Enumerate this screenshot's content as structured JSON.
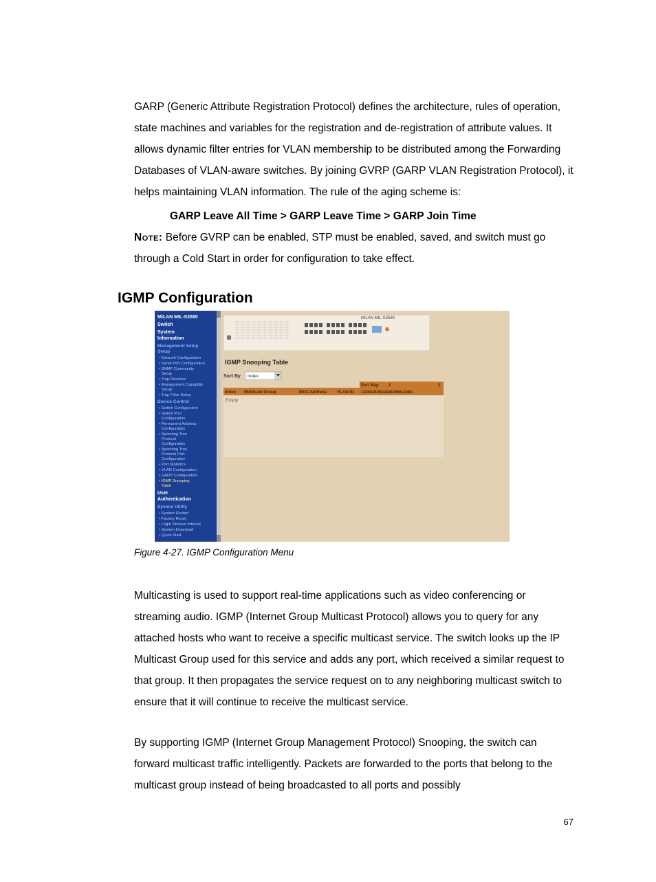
{
  "para1": "GARP (Generic Attribute Registration Protocol) defines the architecture, rules of operation, state machines and variables for the registration and de-registration of attribute values.  It allows dynamic filter entries for VLAN membership to be distributed among the Forwarding Databases of VLAN-aware switches.  By joining GVRP (GARP VLAN Registration Protocol), it helps maintaining VLAN information.  The rule of the aging scheme is:",
  "rule": "GARP Leave All Time > GARP Leave Time > GARP Join Time",
  "note_label": "Note:",
  "note_body_line1": "  Before GVRP can be enabled, STP must be enabled, saved, and switch must go through a Cold Start in order for configuration to take effect.",
  "section_heading": "IGMP Configuration",
  "caption": "Figure 4-27. IGMP Configuration Menu",
  "para2": "Multicasting is used to support real-time applications such as video conferencing or streaming audio.  IGMP (Internet Group Multicast Protocol) allows you to query for any attached hosts who want to receive a specific multicast service.  The switch looks up the IP Multicast Group used for this service and adds any port, which received a similar request to that group.  It then propagates the service request on to any neighboring multicast switch to ensure that it will continue to receive the multicast service.",
  "para3": "By supporting IGMP (Internet Group Management Protocol) Snooping, the switch can forward multicast traffic intelligently.  Packets are forwarded to the ports that belong to the multicast group instead of being broadcasted to all ports and possibly",
  "page_number": "67",
  "screenshot": {
    "device_title": "MiLAN MIL-S3580",
    "nav": {
      "heading1": "Switch",
      "heading2": "System Information",
      "group_mgmt": "Management Setup",
      "items_mgmt": [
        "Network Configuration",
        "Serial Port Configuration",
        "SNMP Community Setup",
        "Trap Receiver",
        "Management Capability Setup",
        "Trap Filter Setup"
      ],
      "group_dev": "Device Control",
      "items_dev": [
        "Switch Configuration",
        "Switch Port Configuration",
        "Permanent Address Configuration",
        "Spanning Tree Protocol Configuration",
        "Spanning Tree Protocol Port Configuration",
        "Port Statistics",
        "VLAN Configuration",
        "GARP Configuration",
        "IGMP Snooping Table"
      ],
      "heading3": "User Authentication",
      "group_util": "System Utility",
      "items_util": [
        "System Restart",
        "Factory Reset",
        "Login Timeout Interval",
        "System Download",
        "Quick Start"
      ]
    },
    "main": {
      "title": "IGMP Snooping Table",
      "sort_label": "Sort By",
      "sort_value": "Index",
      "header_index": "Index",
      "header_group": "Multicast Group",
      "header_mac": "MAC Address",
      "header_vlan": "VLAN ID",
      "header_portmap": "Port Map",
      "port_range_1": "1",
      "port_range_2": "2",
      "port_bits": "123456781901234567890123456",
      "row_empty": "Empty",
      "brand_top": "MiLAN MIL-S3580"
    }
  }
}
